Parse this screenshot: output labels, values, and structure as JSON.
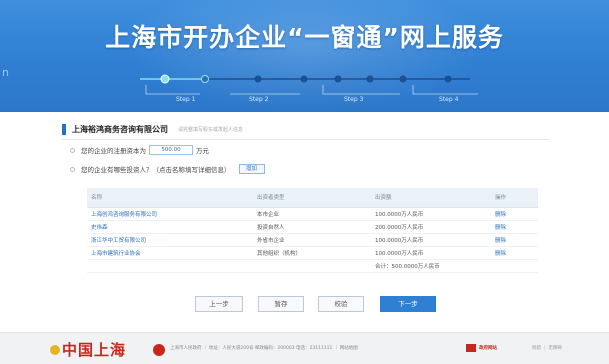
{
  "header": {
    "title": "上海市开办企业“一窗通”网上服务",
    "steps": [
      "Step 1",
      "Step 2",
      "Step 3",
      "Step 4"
    ],
    "colors": {
      "banner": "#2f7fd3",
      "active_step": "#7fe6f5",
      "step_dot": "#1e4f8f"
    }
  },
  "company": {
    "name": "上海裕鸿商务咨询有限公司",
    "hint": "请完整填写股东或发起人信息"
  },
  "questions": {
    "capital_prefix": "您的企业的注册资本为",
    "capital_value": "500.00",
    "capital_unit": "万元",
    "investors_prompt": "您的企业有哪些投资人？（点击名称填写详细信息）",
    "add_label": "增加"
  },
  "table": {
    "columns": [
      "名称",
      "出资者类型",
      "出资额",
      "操作"
    ],
    "rows": [
      {
        "name": "上海创鸿咨询服务有限公司",
        "type": "本市企业",
        "amount": "100.0000万人民币",
        "action": "删除"
      },
      {
        "name": "史伟森",
        "type": "投资自然人",
        "amount": "200.0000万人民币",
        "action": "删除"
      },
      {
        "name": "浙江华中工贸有限公司",
        "type": "外省市企业",
        "amount": "100.0000万人民币",
        "action": "删除"
      },
      {
        "name": "上海市建筑行业协会",
        "type": "其他组织（机构）",
        "amount": "100.0000万人民币",
        "action": "删除"
      }
    ],
    "total": "合计：500.0000万人民币"
  },
  "buttons": {
    "prev": "上一步",
    "save": "暂存",
    "check": "校验",
    "next": "下一步"
  },
  "footer": {
    "logo": "中国上海",
    "info": "上海市人民政府 ｜ 地址：人民大道200号 邮政编码：200003 电话：23111111 ｜ 网站地图",
    "gov_label": "政府网站",
    "right": "找错 ｜ 无障碍"
  }
}
